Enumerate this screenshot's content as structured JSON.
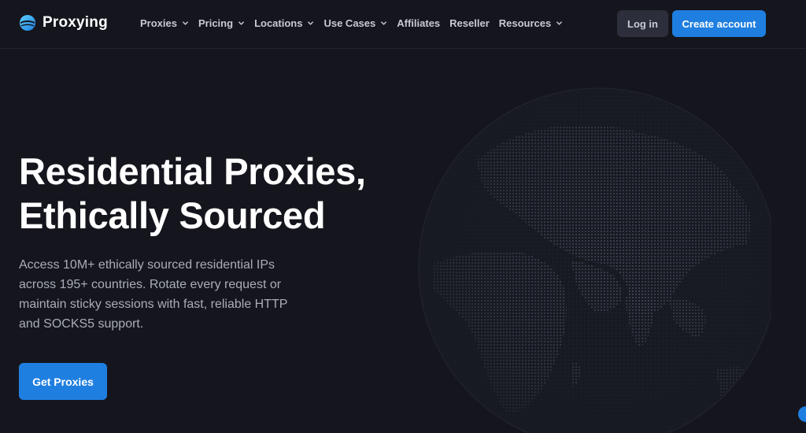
{
  "brand": {
    "name": "Proxying",
    "logo_icon": "proxying-logo-icon",
    "accent_color": "#1f7fe0"
  },
  "nav": {
    "items": [
      {
        "label": "Proxies",
        "has_dropdown": true
      },
      {
        "label": "Pricing",
        "has_dropdown": true
      },
      {
        "label": "Locations",
        "has_dropdown": true
      },
      {
        "label": "Use Cases",
        "has_dropdown": true
      },
      {
        "label": "Affiliates",
        "has_dropdown": false
      },
      {
        "label": "Reseller",
        "has_dropdown": false
      },
      {
        "label": "Resources",
        "has_dropdown": true
      }
    ]
  },
  "header_actions": {
    "login_label": "Log in",
    "create_account_label": "Create account"
  },
  "hero": {
    "title_line1": "Residential Proxies,",
    "title_line2": "Ethically Sourced",
    "description": "Access 10M+ ethically sourced residential IPs across 195+ countries. Rotate every request or maintain sticky sessions with fast, reliable HTTP and SOCKS5 support.",
    "cta_label": "Get Proxies",
    "globe_icon": "dotted-globe-illustration"
  }
}
